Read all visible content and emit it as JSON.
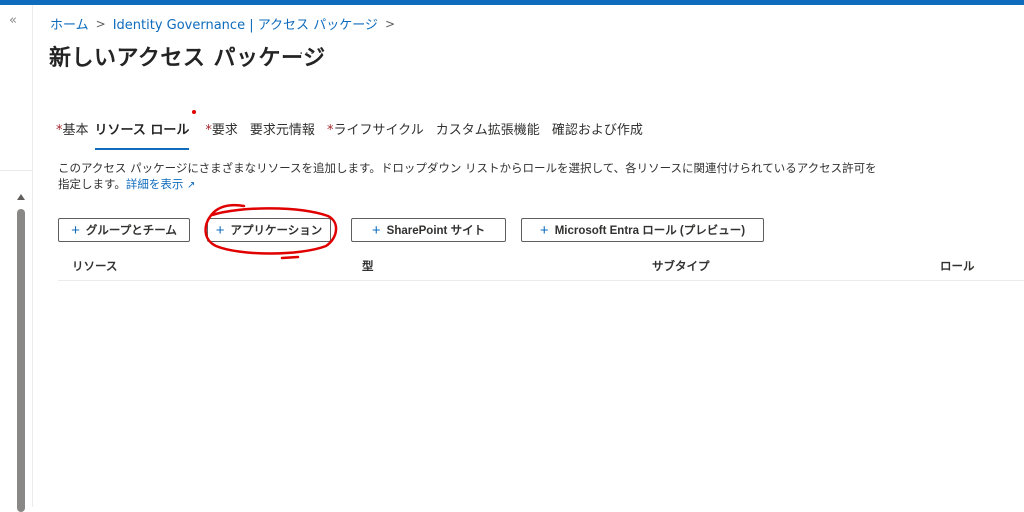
{
  "breadcrumb": {
    "items": [
      "ホーム",
      "Identity Governance | アクセス パッケージ"
    ],
    "separator": ">"
  },
  "page": {
    "title": "新しいアクセス パッケージ",
    "more": "..."
  },
  "tabs": [
    {
      "label": "基本",
      "required": true,
      "active": false
    },
    {
      "label": "リソース ロール",
      "required": false,
      "active": true
    },
    {
      "label": "要求",
      "required": true,
      "active": false
    },
    {
      "label": "要求元情報",
      "required": false,
      "active": false
    },
    {
      "label": "ライフサイクル",
      "required": true,
      "active": false
    },
    {
      "label": "カスタム拡張機能",
      "required": false,
      "active": false
    },
    {
      "label": "確認および作成",
      "required": false,
      "active": false
    }
  ],
  "required_marker": "*",
  "description": {
    "text": "このアクセス パッケージにさまざまなリソースを追加します。ドロップダウン リストからロールを選択して、各リソースに関連付けられているアクセス許可を指定します。",
    "link": "詳細を表示"
  },
  "buttons": {
    "plus": "+",
    "groups": "グループとチーム",
    "applications": "アプリケーション",
    "sharepoint": "SharePoint サイト",
    "entra": "Microsoft Entra ロール (プレビュー)"
  },
  "table": {
    "columns": [
      "リソース",
      "型",
      "サブタイプ",
      "ロール"
    ]
  },
  "rail": {
    "collapse": "«"
  },
  "colors": {
    "accent": "#0f6cbd",
    "required": "#a4262c",
    "annotation": "#e00000"
  }
}
